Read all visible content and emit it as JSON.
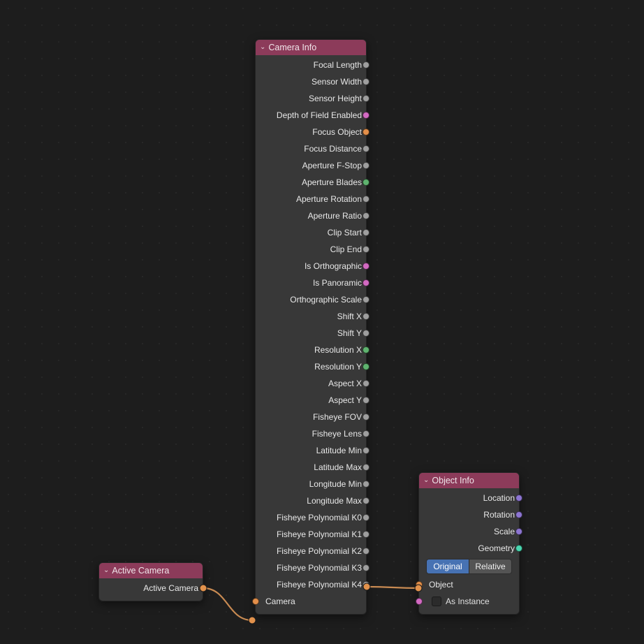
{
  "nodes": {
    "active_camera": {
      "title": "Active Camera",
      "outputs": [
        {
          "label": "Active Camera",
          "socket": "orange"
        }
      ]
    },
    "camera_info": {
      "title": "Camera Info",
      "outputs": [
        {
          "label": "Focal Length",
          "socket": "gray"
        },
        {
          "label": "Sensor Width",
          "socket": "gray"
        },
        {
          "label": "Sensor Height",
          "socket": "gray"
        },
        {
          "label": "Depth of Field Enabled",
          "socket": "magenta"
        },
        {
          "label": "Focus Object",
          "socket": "orange"
        },
        {
          "label": "Focus Distance",
          "socket": "gray"
        },
        {
          "label": "Aperture F-Stop",
          "socket": "gray"
        },
        {
          "label": "Aperture Blades",
          "socket": "green"
        },
        {
          "label": "Aperture Rotation",
          "socket": "gray"
        },
        {
          "label": "Aperture Ratio",
          "socket": "gray"
        },
        {
          "label": "Clip Start",
          "socket": "gray"
        },
        {
          "label": "Clip End",
          "socket": "gray"
        },
        {
          "label": "Is Orthographic",
          "socket": "magenta"
        },
        {
          "label": "Is Panoramic",
          "socket": "magenta"
        },
        {
          "label": "Orthographic Scale",
          "socket": "gray"
        },
        {
          "label": "Shift X",
          "socket": "gray"
        },
        {
          "label": "Shift Y",
          "socket": "gray"
        },
        {
          "label": "Resolution X",
          "socket": "green"
        },
        {
          "label": "Resolution Y",
          "socket": "green"
        },
        {
          "label": "Aspect X",
          "socket": "gray"
        },
        {
          "label": "Aspect Y",
          "socket": "gray"
        },
        {
          "label": "Fisheye FOV",
          "socket": "gray"
        },
        {
          "label": "Fisheye Lens",
          "socket": "gray"
        },
        {
          "label": "Latitude Min",
          "socket": "gray"
        },
        {
          "label": "Latitude Max",
          "socket": "gray"
        },
        {
          "label": "Longitude Min",
          "socket": "gray"
        },
        {
          "label": "Longitude Max",
          "socket": "gray"
        },
        {
          "label": "Fisheye Polynomial K0",
          "socket": "gray"
        },
        {
          "label": "Fisheye Polynomial K1",
          "socket": "gray"
        },
        {
          "label": "Fisheye Polynomial K2",
          "socket": "gray"
        },
        {
          "label": "Fisheye Polynomial K3",
          "socket": "gray"
        },
        {
          "label": "Fisheye Polynomial K4",
          "socket": "gray"
        }
      ],
      "inputs": [
        {
          "label": "Camera",
          "socket": "orange"
        }
      ]
    },
    "object_info": {
      "title": "Object Info",
      "outputs": [
        {
          "label": "Location",
          "socket": "purple"
        },
        {
          "label": "Rotation",
          "socket": "purple"
        },
        {
          "label": "Scale",
          "socket": "purple"
        },
        {
          "label": "Geometry",
          "socket": "teal"
        }
      ],
      "transform_space": {
        "original": "Original",
        "relative": "Relative",
        "active": "original"
      },
      "inputs": [
        {
          "label": "Object",
          "socket": "orange"
        },
        {
          "label": "As Instance",
          "socket": "magenta",
          "checkbox": true
        }
      ]
    }
  }
}
